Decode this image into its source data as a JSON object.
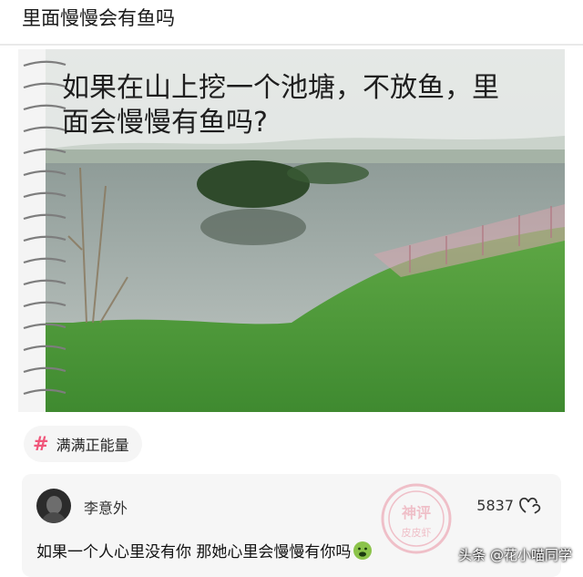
{
  "post": {
    "title": "里面慢慢会有鱼吗"
  },
  "image": {
    "caption_line1": "如果在山上挖一个池塘，不放鱼，里",
    "caption_line2": "面会慢慢有鱼吗?"
  },
  "hashtag": {
    "icon": "hash-icon",
    "label": "满满正能量"
  },
  "comment": {
    "username": "李意外",
    "likes": "5837",
    "text": "如果一个人心里没有你 那她心里会慢慢有你吗",
    "stamp_line1": "神评",
    "stamp_line2": "皮皮虾"
  },
  "watermark": {
    "text": "头条 @花小喵同学"
  },
  "colors": {
    "accent": "#f0567a",
    "grass": "#4f9a3a",
    "water": "#9aa6a2",
    "card_bg": "#f6f6f6"
  }
}
